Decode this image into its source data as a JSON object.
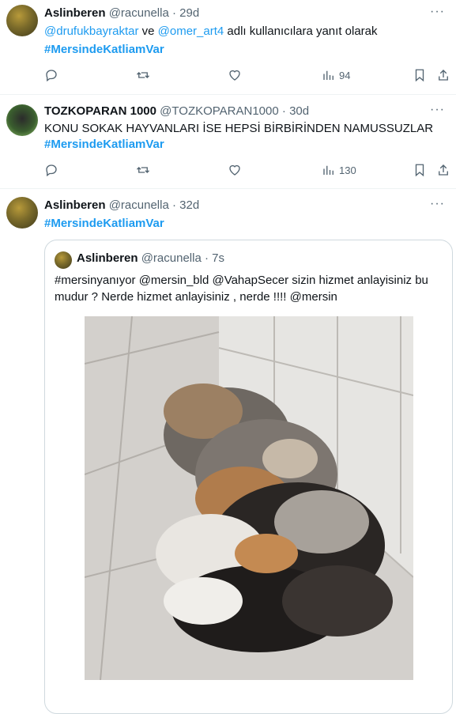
{
  "tweets": [
    {
      "name": "Aslinberen",
      "handle": "@racunella",
      "time": "29d",
      "reply_prefix": "",
      "reply_user1": "@drufukbayraktar",
      "reply_and": " ve ",
      "reply_user2": "@omer_art4",
      "reply_suffix": " adlı kullanıcılara yanıt olarak",
      "hashtag": "#MersindeKatliamVar",
      "views": "94"
    },
    {
      "name": "TOZKOPARAN 1000",
      "handle": "@TOZKOPARAN1000",
      "time": "30d",
      "text": "KONU SOKAK HAYVANLARI İSE HEPSİ BİRBİRİNDEN NAMUSSUZLAR",
      "hashtag": "#MersindeKatliamVar",
      "views": "130"
    },
    {
      "name": "Aslinberen",
      "handle": "@racunella",
      "time": "32d",
      "hashtag": "#MersindeKatliamVar",
      "quote": {
        "name": "Aslinberen",
        "handle": "@racunella",
        "time": "7s",
        "line1": "#mersinyanıyor @mersin_bld @VahapSecer   sizin hizmet anlayisiniz bu",
        "line2": "mudur ? Nerde hizmet anlayisiniz , nerde !!!! @mersin"
      }
    }
  ],
  "ui": {
    "dot": "·",
    "more": "···"
  },
  "icons": [
    "reply-icon",
    "retweet-icon",
    "like-icon",
    "views-icon",
    "bookmark-icon",
    "share-icon"
  ]
}
